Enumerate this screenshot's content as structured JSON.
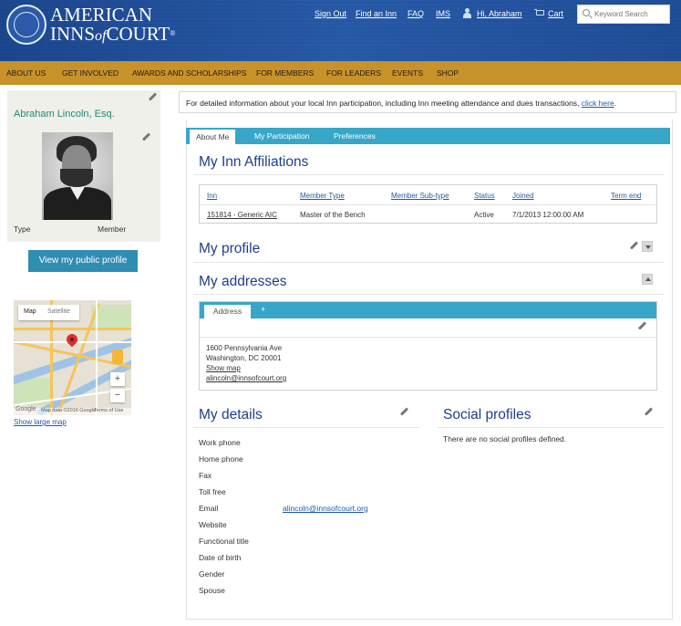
{
  "header": {
    "logo_line1": "AMERICAN",
    "logo_line2_pre": "INNS",
    "logo_line2_of": "of",
    "logo_line2_post": "COURT",
    "logo_tm": "®",
    "links": {
      "sign_out": "Sign Out",
      "find_inn": "Find an Inn",
      "faq": "FAQ",
      "ims": "IMS",
      "greeting": "Hi, Abraham",
      "cart": "Cart"
    },
    "search_placeholder": "Keyword Search"
  },
  "nav": {
    "items": [
      "ABOUT US",
      "GET INVOLVED",
      "AWARDS AND SCHOLARSHIPS",
      "FOR MEMBERS",
      "FOR LEADERS",
      "EVENTS",
      "SHOP"
    ]
  },
  "profile": {
    "name": "Abraham Lincoln, Esq.",
    "type_label": "Type",
    "type_value": "Member",
    "public_profile_button": "View my public profile"
  },
  "map": {
    "tab_map": "Map",
    "tab_satellite": "Satellite",
    "zoom_in": "+",
    "zoom_out": "−",
    "attribution": "Map data ©2016 Google",
    "terms": "Terms of Use",
    "google": "Google",
    "show_large": "Show large map"
  },
  "info_bar": {
    "text": "For detailed information about your local Inn participation, including Inn meeting attendance and dues transactions,",
    "link": "click here",
    "end": "."
  },
  "tabs": [
    "About Me",
    "My Participation",
    "Preferences"
  ],
  "affiliations": {
    "title": "My Inn Affiliations",
    "headers": [
      "Inn",
      "Member Type",
      "Member Sub-type",
      "Status",
      "Joined",
      "Term end"
    ],
    "row": {
      "inn": "151814 - Generic AIC",
      "member_type": "Master of the Bench",
      "member_subtype": "",
      "status": "Active",
      "joined": "7/1/2013 12:00:00 AM",
      "term_end": ""
    }
  },
  "my_profile": {
    "title": "My profile"
  },
  "addresses": {
    "title": "My addresses",
    "tab": "Address",
    "add_tab": "+",
    "line1": "1600 Pennsylvania Ave",
    "line2": "Washington, DC 20001",
    "show_map": "Show map",
    "email": "alincoln@innsofcourt.org"
  },
  "details": {
    "title": "My details",
    "fields": [
      {
        "label": "Work phone",
        "value": ""
      },
      {
        "label": "Home phone",
        "value": ""
      },
      {
        "label": "Fax",
        "value": ""
      },
      {
        "label": "Toll free",
        "value": ""
      },
      {
        "label": "Email",
        "value": "alincoln@innsofcourt.org"
      },
      {
        "label": "Website",
        "value": ""
      },
      {
        "label": "Functional title",
        "value": ""
      },
      {
        "label": "Date of birth",
        "value": ""
      },
      {
        "label": "Gender",
        "value": ""
      },
      {
        "label": "Spouse",
        "value": ""
      }
    ]
  },
  "social": {
    "title": "Social profiles",
    "empty": "There are no social profiles defined."
  },
  "colors": {
    "header_blue": "#2a5aa8",
    "nav_gold": "#c8922b",
    "tab_blue": "#37a6c9",
    "title_blue": "#1c3f8c",
    "name_green": "#1f8a76",
    "button_blue": "#2f8db2"
  }
}
